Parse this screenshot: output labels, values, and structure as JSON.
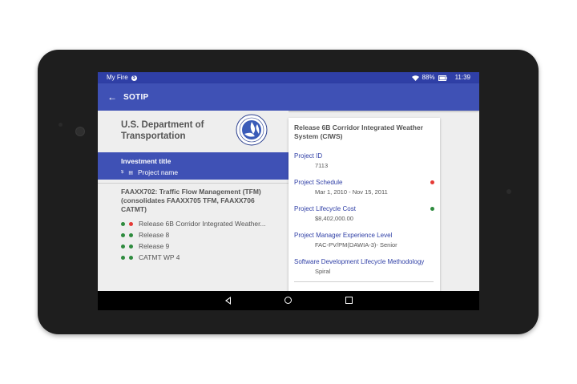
{
  "status_bar": {
    "carrier": "My Fire",
    "battery": "88%",
    "time": "11:39"
  },
  "app_bar": {
    "title": "SOTIP"
  },
  "department": {
    "name": "U.S. Department of Transportation"
  },
  "selected_row": {
    "investment_title": "Investment title",
    "project_name": "Project name"
  },
  "project": {
    "title": "FAAXX702: Traffic Flow Management (TFM) (consolidates FAAXX705 TFM, FAAXX706 CATMT)",
    "releases": [
      {
        "label": "Release 6B Corridor Integrated Weather...",
        "dots": [
          "green",
          "red"
        ]
      },
      {
        "label": "Release 8",
        "dots": [
          "green",
          "green"
        ]
      },
      {
        "label": "Release 9",
        "dots": [
          "green",
          "green"
        ]
      },
      {
        "label": "CATMT WP 4",
        "dots": [
          "green",
          "green"
        ]
      }
    ]
  },
  "detail_card": {
    "title": "Release 6B Corridor Integrated Weather System (CIWS)",
    "project_id_label": "Project ID",
    "project_id": "7113",
    "schedule_label": "Project Schedule",
    "schedule": "Mar 1, 2010 - Nov 15, 2011",
    "schedule_status": "red",
    "cost_label": "Project Lifecycle Cost",
    "cost": "$8,402,000.00",
    "cost_status": "green",
    "pm_label": "Project Manager Experience Level",
    "pm": "FAC-PV/PM(DAWIA-3)- Senior",
    "sdlc_label": "Software Development Lifecycle Methodology",
    "sdlc": "Spiral"
  },
  "colors": {
    "primary": "#3f51b5",
    "status_bar": "#2f3fa6",
    "green": "#2e8b3e",
    "red": "#e53935"
  },
  "icons": [
    "back-arrow-icon",
    "wifi-icon",
    "battery-icon",
    "nav-back-icon",
    "nav-home-icon",
    "nav-recent-icon"
  ]
}
